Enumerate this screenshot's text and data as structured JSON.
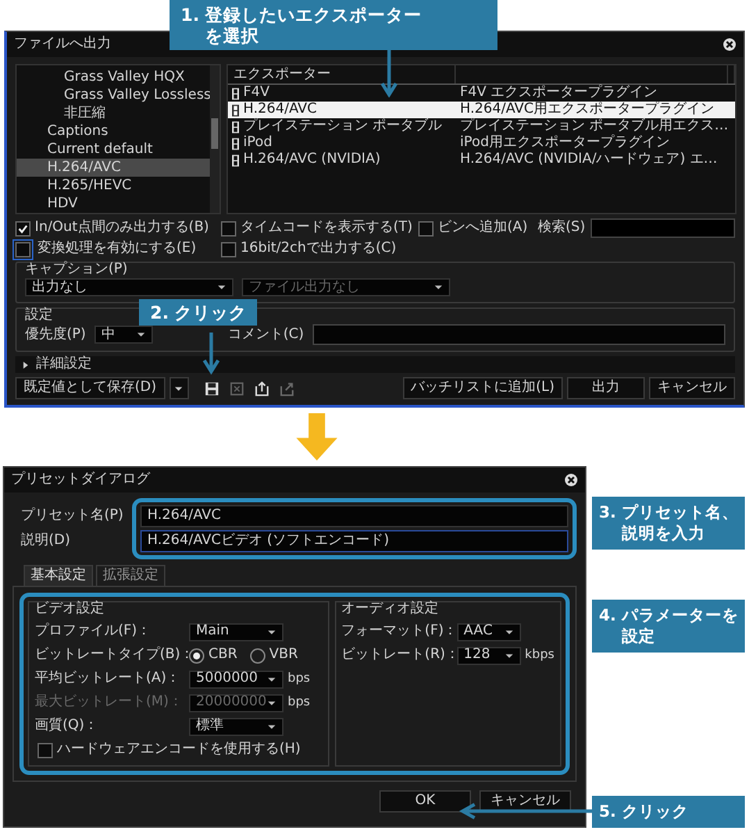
{
  "export_dialog": {
    "title": "ファイルへ出力",
    "tree": [
      {
        "children": [
          {
            "label": "Grass Valley HQX",
            "selected": false
          },
          {
            "label": "Grass Valley Lossless",
            "selected": false
          },
          {
            "label": "非圧縮",
            "selected": false
          }
        ]
      },
      {
        "label": "Captions",
        "selected": false
      },
      {
        "label": "Current default",
        "selected": false
      },
      {
        "label": "H.264/AVC",
        "selected": true
      },
      {
        "label": "H.265/HEVC",
        "selected": false
      },
      {
        "label": "HDV",
        "selected": false
      }
    ],
    "exporter_column": "エクスポーター",
    "exporters": [
      {
        "name": "F4V",
        "description": "F4V エクスポータープラグイン",
        "selected": false
      },
      {
        "name": "H.264/AVC",
        "description": "H.264/AVC用エクスポータープラグイン",
        "selected": true
      },
      {
        "name": "プレイステーション ポータブル",
        "description": "プレイステーション ポータブル用エクス…",
        "selected": false
      },
      {
        "name": "iPod",
        "description": "iPod用エクスポータープラグイン",
        "selected": false
      },
      {
        "name": "H.264/AVC (NVIDIA)",
        "description": "H.264/AVC (NVIDIA/ハードウェア) エ…",
        "selected": false
      }
    ],
    "options": [
      {
        "label": "In/Out点間のみ出力する(B)",
        "checked": true,
        "focused": false
      },
      {
        "label": "タイムコードを表示する(T)",
        "checked": false,
        "focused": false
      },
      {
        "label": "ビンへ追加(A)",
        "checked": false,
        "focused": false
      },
      {
        "label": "変換処理を有効にする(E)",
        "checked": false,
        "focused": true
      },
      {
        "label": "16bit/2chで出力する(C)",
        "checked": false,
        "focused": false
      }
    ],
    "search": {
      "label": "検索(S)"
    },
    "caption": {
      "title": "キャプション(P)",
      "dropdowns": [
        {
          "value": "出力なし",
          "disabled": false
        },
        {
          "value": "ファイル出力なし",
          "disabled": true
        }
      ]
    },
    "settings": {
      "title": "設定",
      "priority_label": "優先度(P)",
      "priority": "中",
      "comment_label": "コメント(C)"
    },
    "details": {
      "label": "詳細設定",
      "expanded": false
    },
    "save_preset": "既定値として保存(D)",
    "tools": [
      {
        "kind": "save",
        "disabled": false
      },
      {
        "kind": "delete",
        "disabled": true
      },
      {
        "kind": "import",
        "disabled": false
      },
      {
        "kind": "export",
        "disabled": true
      }
    ],
    "buttons": [
      "バッチリストに追加(L)",
      "出力",
      "キャンセル"
    ]
  },
  "preset_dialog": {
    "title": "プリセットダイアログ",
    "fields": [
      {
        "label": "プリセット名(P)",
        "value": "H.264/AVC",
        "focused": false
      },
      {
        "label": "説明(D)",
        "value": "H.264/AVCビデオ (ソフトエンコード)",
        "focused": true
      }
    ],
    "tabs": [
      {
        "label": "基本設定",
        "selected": true
      },
      {
        "label": "拡張設定",
        "selected": false
      }
    ],
    "video": {
      "title": "ビデオ設定",
      "rows": [
        {
          "kind": "dropdown",
          "label": "プロファイル(F)：",
          "value": "Main",
          "disabled": false
        },
        {
          "kind": "radio",
          "label": "ビットレートタイプ(B)：",
          "options": [
            {
              "label": "CBR",
              "selected": true
            },
            {
              "label": "VBR",
              "selected": false
            }
          ]
        },
        {
          "kind": "dropdown",
          "label": "平均ビットレート(A)：",
          "value": "5000000",
          "unit": "bps",
          "disabled": false
        },
        {
          "kind": "dropdown",
          "label": "最大ビットレート(M)：",
          "value": "20000000",
          "unit": "bps",
          "disabled": true
        },
        {
          "kind": "dropdown",
          "label": "画質(Q)：",
          "value": "標準",
          "disabled": false
        },
        {
          "kind": "checkbox",
          "label": "ハードウェアエンコードを使用する(H)",
          "checked": false
        }
      ]
    },
    "audio": {
      "title": "オーディオ設定",
      "rows": [
        {
          "kind": "dropdown",
          "label": "フォーマット(F)：",
          "value": "AAC",
          "disabled": false
        },
        {
          "kind": "dropdown",
          "label": "ビットレート(R)：",
          "value": "128",
          "unit": "kbps",
          "disabled": false
        }
      ]
    },
    "buttons": [
      "OK",
      "キャンセル"
    ]
  },
  "callouts": [
    {
      "number": "1.",
      "lines": [
        "登録したいエクスポーター",
        "を選択"
      ]
    },
    {
      "number": "2.",
      "lines": [
        "クリック"
      ]
    },
    {
      "number": "3.",
      "lines": [
        "プリセット名、",
        "説明を入力"
      ]
    },
    {
      "number": "4.",
      "lines": [
        "パラメーターを",
        "設定"
      ]
    },
    {
      "number": "5.",
      "lines": [
        "クリック"
      ]
    }
  ]
}
